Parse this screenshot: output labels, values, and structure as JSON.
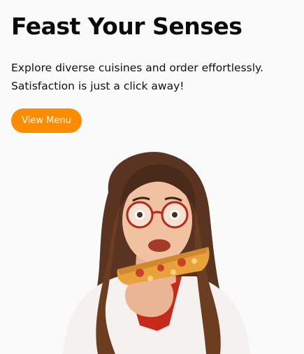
{
  "hero": {
    "title": "Feast Your Senses",
    "subtitle": "Explore diverse cuisines and order effortlessly. Satisfaction is just a click away!",
    "cta_label": "View Menu"
  },
  "colors": {
    "background": "#fafafa",
    "accent": "#ff8c00",
    "text": "#111111"
  }
}
